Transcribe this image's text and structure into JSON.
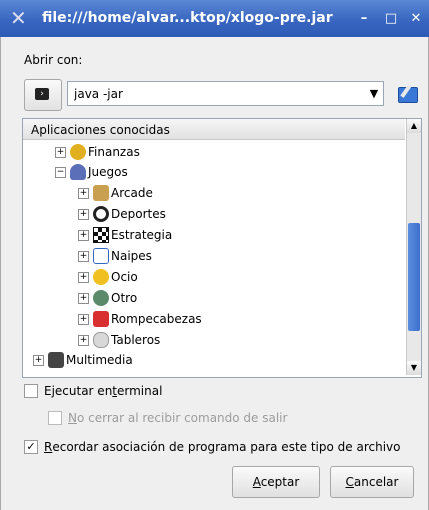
{
  "window": {
    "title": "file:///home/alvar...ktop/xlogo-pre.jar",
    "minimize_glyph": "–",
    "maximize_glyph": "□",
    "close_glyph": "✕",
    "icon_glyph": "✕"
  },
  "open_with_label": "Abrir con:",
  "command": {
    "value": "java -jar",
    "dropdown_glyph": "▼"
  },
  "tree": {
    "header": "Aplicaciones conocidas",
    "items": [
      {
        "label": "Finanzas",
        "expander": "+",
        "icon": "finance-icon",
        "icon_color": "#e0b020"
      },
      {
        "label": "Juegos",
        "expander": "−",
        "icon": "games-icon",
        "icon_color": "#5a6fb8"
      },
      {
        "label": "Arcade",
        "expander": "+",
        "icon": "arcade-icon",
        "icon_color": "#c8a050"
      },
      {
        "label": "Deportes",
        "expander": "+",
        "icon": "sports-icon",
        "icon_color": "#222222"
      },
      {
        "label": "Estrategia",
        "expander": "+",
        "icon": "strategy-icon",
        "icon_color": "#111111"
      },
      {
        "label": "Naipes",
        "expander": "+",
        "icon": "cards-icon",
        "icon_color": "#3468c8"
      },
      {
        "label": "Ocio",
        "expander": "+",
        "icon": "leisure-icon",
        "icon_color": "#f0c020"
      },
      {
        "label": "Otro",
        "expander": "+",
        "icon": "other-icon",
        "icon_color": "#5a8a6a"
      },
      {
        "label": "Rompecabezas",
        "expander": "+",
        "icon": "puzzle-icon",
        "icon_color": "#d83030"
      },
      {
        "label": "Tableros",
        "expander": "+",
        "icon": "boards-icon",
        "icon_color": "#9a9a9a"
      },
      {
        "label": "Multimedia",
        "expander": "+",
        "icon": "multimedia-icon",
        "icon_color": "#444444"
      }
    ]
  },
  "options": {
    "run_in_terminal": {
      "prefix": "Ejecutar en ",
      "accel": "t",
      "suffix": "erminal",
      "checked": false
    },
    "no_close": {
      "accel": "N",
      "suffix": "o cerrar al recibir comando de salir",
      "checked": false
    },
    "remember": {
      "accel": "R",
      "suffix": "ecordar asociación de programa para este tipo de archivo",
      "checked": true,
      "check_glyph": "✓"
    }
  },
  "buttons": {
    "accept": {
      "accel": "A",
      "suffix": "ceptar"
    },
    "cancel": {
      "accel": "C",
      "suffix": "ancelar"
    }
  }
}
